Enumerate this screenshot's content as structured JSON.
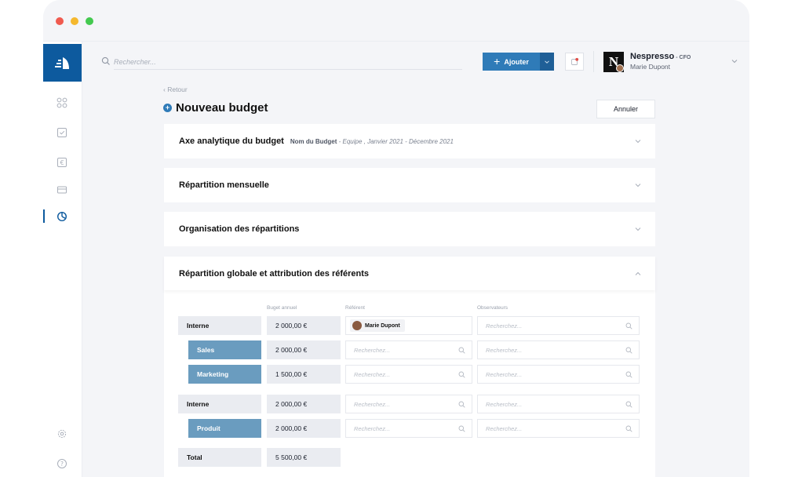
{
  "topbar": {
    "search_placeholder": "Rechercher...",
    "add_label": "Ajouter",
    "company": {
      "name": "Nespresso",
      "role": "- CFO"
    },
    "user": {
      "name": "Marie Dupont"
    }
  },
  "page": {
    "back_label": "Retour",
    "title": "Nouveau budget",
    "cancel_label": "Annuler"
  },
  "panels": [
    {
      "title": "Axe analytique du budget",
      "subtitle": "Nom du Budget",
      "detail": " - Equipe , Janvier 2021 - Décembre 2021"
    },
    {
      "title": "Répartition mensuelle"
    },
    {
      "title": "Organisation des répartitions"
    }
  ],
  "allocation": {
    "title": "Répartition globale et attribution des référents",
    "columns": {
      "budget": "Buget annuel",
      "referent": "Référent",
      "observers": "Observateurs"
    },
    "search_placeholder": "Recherchez...",
    "rows": [
      {
        "label": "Interne",
        "amount": "2 000,00 €",
        "referent": "Marie Dupont"
      },
      {
        "label": "Sales",
        "amount": "2 000,00 €"
      },
      {
        "label": "Marketing",
        "amount": "1 500,00 €"
      },
      {
        "label": "Interne",
        "amount": "2 000,00 €"
      },
      {
        "label": "Produit",
        "amount": "2 000,00 €"
      },
      {
        "label": "Total",
        "amount": "5 500,00 €"
      }
    ]
  },
  "colors": {
    "primary": "#2f7bb8",
    "brand_dark": "#0d5a9e",
    "sub_row": "#6a9cbf"
  }
}
